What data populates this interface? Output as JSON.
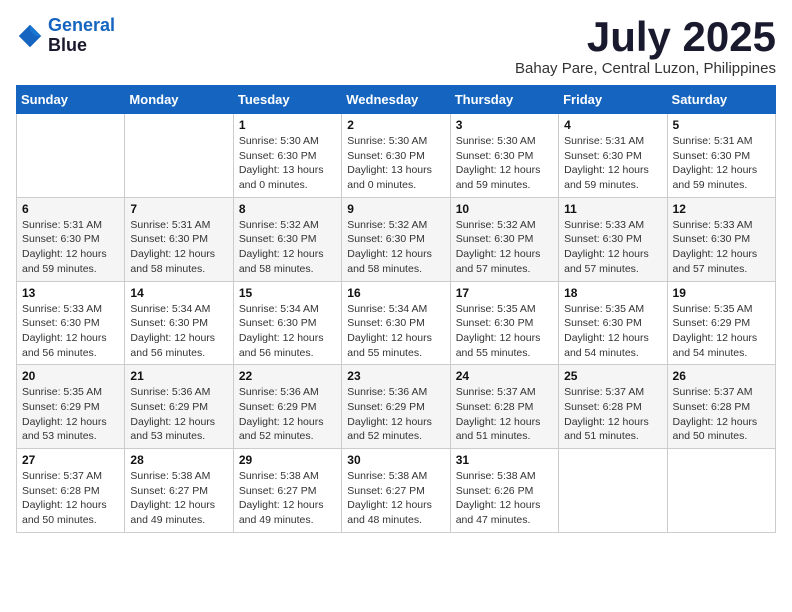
{
  "logo": {
    "line1": "General",
    "line2": "Blue"
  },
  "title": "July 2025",
  "subtitle": "Bahay Pare, Central Luzon, Philippines",
  "days_of_week": [
    "Sunday",
    "Monday",
    "Tuesday",
    "Wednesday",
    "Thursday",
    "Friday",
    "Saturday"
  ],
  "weeks": [
    [
      {
        "day": "",
        "info": ""
      },
      {
        "day": "",
        "info": ""
      },
      {
        "day": "1",
        "info": "Sunrise: 5:30 AM\nSunset: 6:30 PM\nDaylight: 13 hours and 0 minutes."
      },
      {
        "day": "2",
        "info": "Sunrise: 5:30 AM\nSunset: 6:30 PM\nDaylight: 13 hours and 0 minutes."
      },
      {
        "day": "3",
        "info": "Sunrise: 5:30 AM\nSunset: 6:30 PM\nDaylight: 12 hours and 59 minutes."
      },
      {
        "day": "4",
        "info": "Sunrise: 5:31 AM\nSunset: 6:30 PM\nDaylight: 12 hours and 59 minutes."
      },
      {
        "day": "5",
        "info": "Sunrise: 5:31 AM\nSunset: 6:30 PM\nDaylight: 12 hours and 59 minutes."
      }
    ],
    [
      {
        "day": "6",
        "info": "Sunrise: 5:31 AM\nSunset: 6:30 PM\nDaylight: 12 hours and 59 minutes."
      },
      {
        "day": "7",
        "info": "Sunrise: 5:31 AM\nSunset: 6:30 PM\nDaylight: 12 hours and 58 minutes."
      },
      {
        "day": "8",
        "info": "Sunrise: 5:32 AM\nSunset: 6:30 PM\nDaylight: 12 hours and 58 minutes."
      },
      {
        "day": "9",
        "info": "Sunrise: 5:32 AM\nSunset: 6:30 PM\nDaylight: 12 hours and 58 minutes."
      },
      {
        "day": "10",
        "info": "Sunrise: 5:32 AM\nSunset: 6:30 PM\nDaylight: 12 hours and 57 minutes."
      },
      {
        "day": "11",
        "info": "Sunrise: 5:33 AM\nSunset: 6:30 PM\nDaylight: 12 hours and 57 minutes."
      },
      {
        "day": "12",
        "info": "Sunrise: 5:33 AM\nSunset: 6:30 PM\nDaylight: 12 hours and 57 minutes."
      }
    ],
    [
      {
        "day": "13",
        "info": "Sunrise: 5:33 AM\nSunset: 6:30 PM\nDaylight: 12 hours and 56 minutes."
      },
      {
        "day": "14",
        "info": "Sunrise: 5:34 AM\nSunset: 6:30 PM\nDaylight: 12 hours and 56 minutes."
      },
      {
        "day": "15",
        "info": "Sunrise: 5:34 AM\nSunset: 6:30 PM\nDaylight: 12 hours and 56 minutes."
      },
      {
        "day": "16",
        "info": "Sunrise: 5:34 AM\nSunset: 6:30 PM\nDaylight: 12 hours and 55 minutes."
      },
      {
        "day": "17",
        "info": "Sunrise: 5:35 AM\nSunset: 6:30 PM\nDaylight: 12 hours and 55 minutes."
      },
      {
        "day": "18",
        "info": "Sunrise: 5:35 AM\nSunset: 6:30 PM\nDaylight: 12 hours and 54 minutes."
      },
      {
        "day": "19",
        "info": "Sunrise: 5:35 AM\nSunset: 6:29 PM\nDaylight: 12 hours and 54 minutes."
      }
    ],
    [
      {
        "day": "20",
        "info": "Sunrise: 5:35 AM\nSunset: 6:29 PM\nDaylight: 12 hours and 53 minutes."
      },
      {
        "day": "21",
        "info": "Sunrise: 5:36 AM\nSunset: 6:29 PM\nDaylight: 12 hours and 53 minutes."
      },
      {
        "day": "22",
        "info": "Sunrise: 5:36 AM\nSunset: 6:29 PM\nDaylight: 12 hours and 52 minutes."
      },
      {
        "day": "23",
        "info": "Sunrise: 5:36 AM\nSunset: 6:29 PM\nDaylight: 12 hours and 52 minutes."
      },
      {
        "day": "24",
        "info": "Sunrise: 5:37 AM\nSunset: 6:28 PM\nDaylight: 12 hours and 51 minutes."
      },
      {
        "day": "25",
        "info": "Sunrise: 5:37 AM\nSunset: 6:28 PM\nDaylight: 12 hours and 51 minutes."
      },
      {
        "day": "26",
        "info": "Sunrise: 5:37 AM\nSunset: 6:28 PM\nDaylight: 12 hours and 50 minutes."
      }
    ],
    [
      {
        "day": "27",
        "info": "Sunrise: 5:37 AM\nSunset: 6:28 PM\nDaylight: 12 hours and 50 minutes."
      },
      {
        "day": "28",
        "info": "Sunrise: 5:38 AM\nSunset: 6:27 PM\nDaylight: 12 hours and 49 minutes."
      },
      {
        "day": "29",
        "info": "Sunrise: 5:38 AM\nSunset: 6:27 PM\nDaylight: 12 hours and 49 minutes."
      },
      {
        "day": "30",
        "info": "Sunrise: 5:38 AM\nSunset: 6:27 PM\nDaylight: 12 hours and 48 minutes."
      },
      {
        "day": "31",
        "info": "Sunrise: 5:38 AM\nSunset: 6:26 PM\nDaylight: 12 hours and 47 minutes."
      },
      {
        "day": "",
        "info": ""
      },
      {
        "day": "",
        "info": ""
      }
    ]
  ]
}
